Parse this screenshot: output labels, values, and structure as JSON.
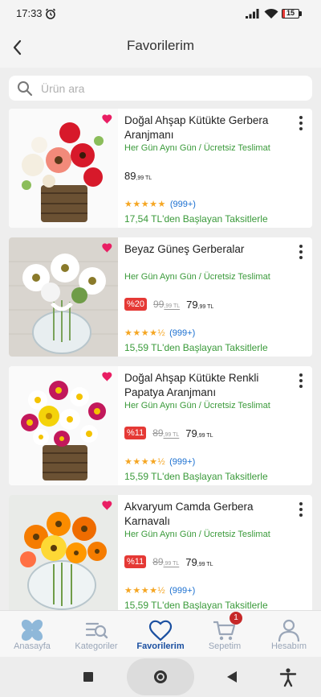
{
  "status": {
    "time": "17:33",
    "battery": "15",
    "battery_fraction": 0.15
  },
  "header": {
    "title": "Favorilerim"
  },
  "search": {
    "placeholder": "Ürün ara"
  },
  "products": [
    {
      "title": "Doğal Ahşap Kütükte Gerbera Aranjmanı",
      "delivery": "Her Gün Aynı Gün / Ücretsiz Teslimat",
      "discount": "",
      "old_price_main": "",
      "old_price_cents": "",
      "price_main": "89",
      "price_cents": ",99 TL",
      "stars": "★★★★★",
      "reviews": "(999+)",
      "installment": "17,54 TL'den Başlayan Taksitlerle"
    },
    {
      "title": "Beyaz Güneş Gerberalar",
      "delivery": "Her Gün Aynı Gün / Ücretsiz Teslimat",
      "discount": "%20",
      "old_price_main": "99",
      "old_price_cents": ",99 TL",
      "price_main": "79",
      "price_cents": ",99 TL",
      "stars": "★★★★½",
      "reviews": "(999+)",
      "installment": "15,59 TL'den Başlayan Taksitlerle"
    },
    {
      "title": "Doğal Ahşap Kütükte Renkli Papatya Aranjmanı",
      "delivery": "Her Gün Aynı Gün / Ücretsiz Teslimat",
      "discount": "%11",
      "old_price_main": "89",
      "old_price_cents": ",99 TL",
      "price_main": "79",
      "price_cents": ",99 TL",
      "stars": "★★★★½",
      "reviews": "(999+)",
      "installment": "15,59 TL'den Başlayan Taksitlerle"
    },
    {
      "title": "Akvaryum Camda Gerbera Karnavalı",
      "delivery": "Her Gün Aynı Gün / Ücretsiz Teslimat",
      "discount": "%11",
      "old_price_main": "89",
      "old_price_cents": ",99 TL",
      "price_main": "79",
      "price_cents": ",99 TL",
      "stars": "★★★★½",
      "reviews": "(999+)",
      "installment": "15,59 TL'den Başlayan Taksitlerle"
    }
  ],
  "bottom_nav": {
    "home": "Anasayfa",
    "categories": "Kategoriler",
    "favorites": "Favorilerim",
    "cart": "Sepetim",
    "account": "Hesabım",
    "cart_badge": "1"
  },
  "colors": {
    "accent": "#1a4fa0",
    "heart": "#e91e63",
    "discount": "#e53935",
    "delivery_green": "#3a9a3a",
    "star": "#f5a623"
  },
  "icons": [
    "alarm-icon",
    "signal-icon",
    "wifi-icon",
    "battery-icon",
    "back-arrow-icon",
    "search-icon",
    "heart-icon",
    "more-vertical-icon",
    "home-icon",
    "categories-icon",
    "favorites-heart-icon",
    "cart-icon",
    "account-icon"
  ]
}
